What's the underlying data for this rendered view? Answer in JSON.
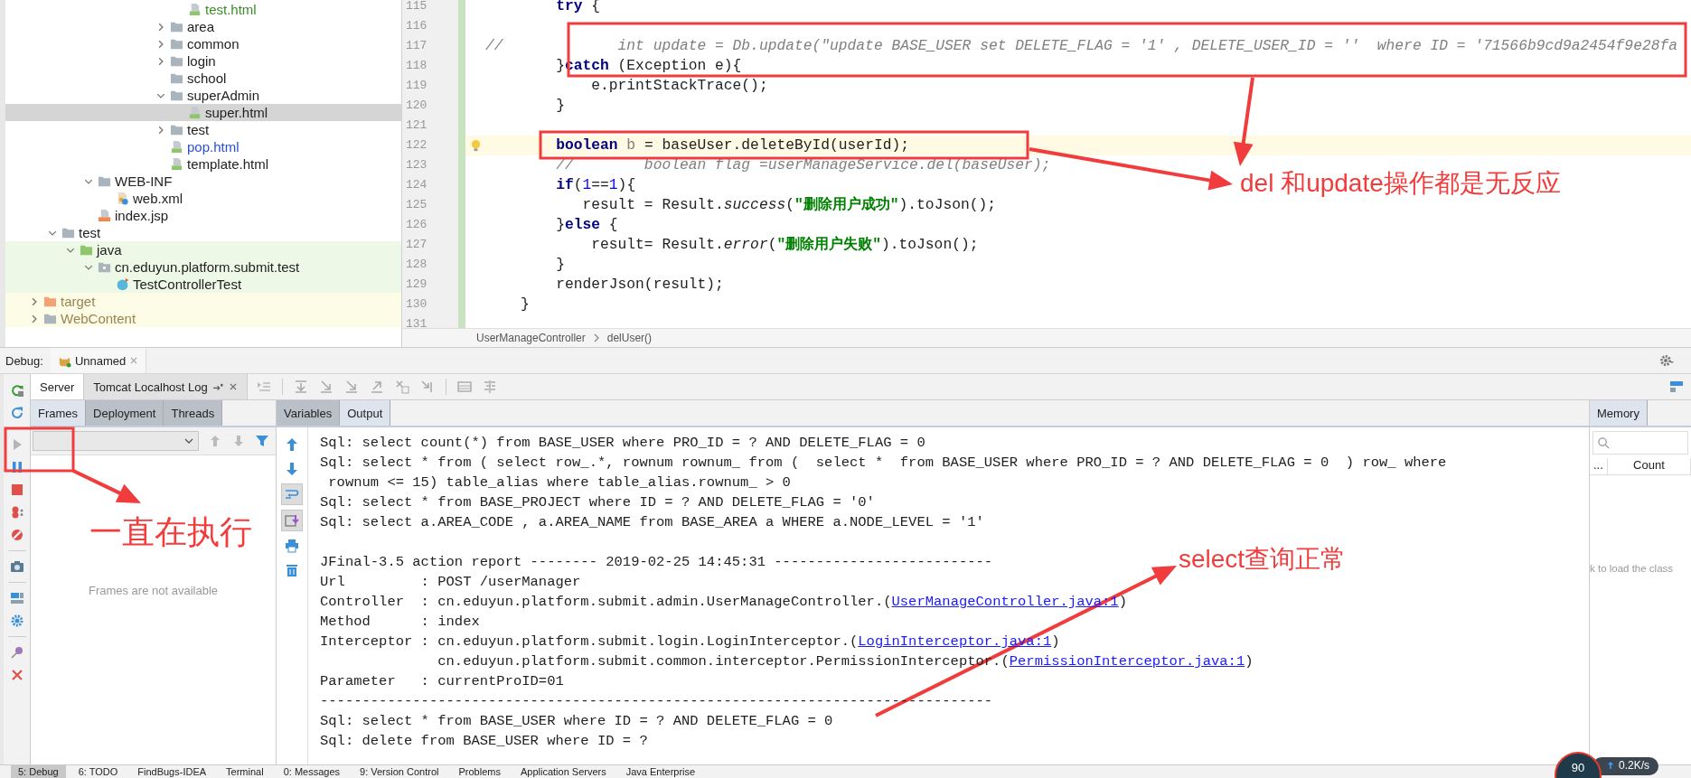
{
  "project_tree": {
    "items": [
      {
        "kind": "hidden",
        "children": [
          {
            "kind": "hidden",
            "children": [
              {
                "kind": "hidden",
                "children": [
                  {
                    "kind": "hidden",
                    "children": [
                      {
                        "kind": "hidden",
                        "children": [
                          {
                            "kind": "hidden",
                            "children": [
                              {
                                "kind": "hidden",
                                "children": [
                                  {
                                    "kind": "hidden",
                                    "children": [
                                      {
                                        "kind": "html",
                                        "label": "test.html",
                                        "selected": false,
                                        "color": "#3c8c2c"
                                      }
                                    ]
                                  },
                                  {
                                    "kind": "folder",
                                    "label": "area",
                                    "selected": false,
                                    "expanded": false
                                  },
                                  {
                                    "kind": "folder",
                                    "label": "common",
                                    "selected": false,
                                    "expanded": false
                                  },
                                  {
                                    "kind": "folder",
                                    "label": "login",
                                    "selected": false,
                                    "expanded": false
                                  },
                                  {
                                    "kind": "folder",
                                    "label": "school",
                                    "selected": false
                                  },
                                  {
                                    "kind": "folder",
                                    "label": "superAdmin",
                                    "selected": false,
                                    "expanded": true,
                                    "children": [
                                      {
                                        "kind": "html",
                                        "label": "super.html",
                                        "selected": true
                                      }
                                    ]
                                  },
                                  {
                                    "kind": "folder",
                                    "label": "test",
                                    "selected": false,
                                    "expanded": false
                                  },
                                  {
                                    "kind": "html",
                                    "label": "pop.html",
                                    "selected": false,
                                    "color": "#2a4fd6"
                                  },
                                  {
                                    "kind": "html",
                                    "label": "template.html",
                                    "selected": false
                                  }
                                ]
                              }
                            ]
                          }
                        ]
                      }
                    ]
                  },
                  {
                    "kind": "folder",
                    "label": "WEB-INF",
                    "selected": false,
                    "expanded": true,
                    "children": [
                      {
                        "kind": "xml",
                        "label": "web.xml",
                        "selected": false
                      }
                    ]
                  },
                  {
                    "kind": "jsp",
                    "label": "index.jsp",
                    "selected": false
                  }
                ]
              }
            ]
          },
          {
            "kind": "folder",
            "label": "test",
            "selected": false,
            "expanded": true,
            "children": [
              {
                "kind": "source",
                "label": "java",
                "selected": false,
                "expanded": true,
                "test_scope": true,
                "children": [
                  {
                    "kind": "package",
                    "label": "cn.eduyun.platform.submit.test",
                    "selected": false,
                    "expanded": true,
                    "test_scope": true,
                    "children": [
                      {
                        "kind": "class",
                        "label": "TestControllerTest",
                        "selected": false,
                        "test_scope": true
                      }
                    ]
                  }
                ]
              }
            ]
          }
        ]
      },
      {
        "kind": "excluded",
        "label": "target",
        "selected": false,
        "expanded": false,
        "excluded": true
      },
      {
        "kind": "folder",
        "label": "WebContent",
        "selected": false,
        "expanded": false,
        "excluded": true
      }
    ]
  },
  "editor": {
    "lines": [
      {
        "no": "115",
        "current": false,
        "segs": [
          {
            "t": "        try",
            "kind": "keyword"
          },
          {
            "t": " {",
            "kind": "plain"
          }
        ]
      },
      {
        "no": "116",
        "current": false
      },
      {
        "no": "117",
        "current": false,
        "segs": [
          {
            "t": "//             int update = Db.update(\"update BASE_USER set DELETE_FLAG = '1' , DELETE_USER_ID = ''  where ID = '71566b9cd9a2454f9e28fa",
            "kind": "comment"
          }
        ]
      },
      {
        "no": "118",
        "current": false,
        "segs": [
          {
            "t": "        }",
            "kind": "plain"
          },
          {
            "t": "catch",
            "kind": "keyword"
          },
          {
            "t": " (Exception e){",
            "kind": "plain"
          }
        ]
      },
      {
        "no": "119",
        "current": false,
        "segs": [
          {
            "t": "            e.printStackTrace();",
            "kind": "plain"
          }
        ]
      },
      {
        "no": "120",
        "current": false,
        "segs": [
          {
            "t": "        }",
            "kind": "plain"
          }
        ]
      },
      {
        "no": "121",
        "current": false
      },
      {
        "no": "122",
        "current": true,
        "segs": [
          {
            "t": "        boolean",
            "kind": "keyword"
          },
          {
            "t": " b",
            "kind": "unused"
          },
          {
            "t": " = baseUser.deleteById(userId);",
            "kind": "plain"
          }
        ]
      },
      {
        "no": "123",
        "current": false,
        "segs": [
          {
            "t": "        //        boolean flag =userManageService.del(baseUser);",
            "kind": "comment"
          }
        ]
      },
      {
        "no": "124",
        "current": false,
        "segs": [
          {
            "t": "        if",
            "kind": "keyword"
          },
          {
            "t": "(",
            "kind": "plain"
          },
          {
            "t": "1",
            "kind": "number"
          },
          {
            "t": "==",
            "kind": "plain"
          },
          {
            "t": "1",
            "kind": "number"
          },
          {
            "t": "){",
            "kind": "plain"
          }
        ]
      },
      {
        "no": "125",
        "current": false,
        "segs": [
          {
            "t": "           result = Result.",
            "kind": "plain"
          },
          {
            "t": "success",
            "kind": "static"
          },
          {
            "t": "(",
            "kind": "plain"
          },
          {
            "t": "\"删除用户成功\"",
            "kind": "string"
          },
          {
            "t": ").toJson();",
            "kind": "plain"
          }
        ]
      },
      {
        "no": "126",
        "current": false,
        "segs": [
          {
            "t": "        }",
            "kind": "plain"
          },
          {
            "t": "else",
            "kind": "keyword"
          },
          {
            "t": " {",
            "kind": "plain"
          }
        ]
      },
      {
        "no": "127",
        "current": false,
        "segs": [
          {
            "t": "            result= Result.",
            "kind": "plain"
          },
          {
            "t": "error",
            "kind": "static"
          },
          {
            "t": "(",
            "kind": "plain"
          },
          {
            "t": "\"删除用户失败\"",
            "kind": "string"
          },
          {
            "t": ").toJson();",
            "kind": "plain"
          }
        ]
      },
      {
        "no": "128",
        "current": false,
        "segs": [
          {
            "t": "        }",
            "kind": "plain"
          }
        ]
      },
      {
        "no": "129",
        "current": false,
        "segs": [
          {
            "t": "        renderJson(result);",
            "kind": "plain"
          }
        ]
      },
      {
        "no": "130",
        "current": false,
        "segs": [
          {
            "t": "    }",
            "kind": "plain"
          }
        ]
      },
      {
        "no": "131",
        "current": false
      }
    ],
    "breadcrumb": [
      "UserManageController",
      "delUser()"
    ]
  },
  "annotations": [
    "del 和update操作都是无反应",
    "一直在执行",
    "select查询正常"
  ],
  "debug": {
    "title": "Debug:",
    "session_tab": "Unnamed",
    "tabs": [
      {
        "label": "Server",
        "selected": true,
        "closable": false
      },
      {
        "label": "Tomcat Localhost Log",
        "selected": false,
        "closable": true
      }
    ],
    "left_tabs": [
      {
        "label": "Frames",
        "selected": true
      },
      {
        "label": "Deployment",
        "selected": false
      },
      {
        "label": "Threads",
        "selected": false
      }
    ],
    "frames_empty": "Frames are not available",
    "output_tabs": [
      {
        "label": "Variables",
        "selected": false
      },
      {
        "label": "Output",
        "selected": true
      }
    ],
    "output_lines": [
      {
        "kind": "text",
        "segs": [
          {
            "t": "Sql: select count(*) from BASE_USER where PRO_ID = ? AND DELETE_FLAG = 0",
            "kind": "text"
          }
        ]
      },
      {
        "kind": "text",
        "segs": [
          {
            "t": "Sql: select * from ( select row_.*, rownum rownum_ from (  select *  from BASE_USER where PRO_ID = ? AND DELETE_FLAG = 0  ) row_ where",
            "kind": "text"
          }
        ]
      },
      {
        "kind": "text",
        "segs": [
          {
            "t": " rownum <= 15) table_alias where table_alias.rownum_ > 0",
            "kind": "text"
          }
        ]
      },
      {
        "kind": "text",
        "segs": [
          {
            "t": "Sql: select * from BASE_PROJECT where ID = ? AND DELETE_FLAG = '0'",
            "kind": "text"
          }
        ]
      },
      {
        "kind": "text",
        "segs": [
          {
            "t": "Sql: select a.AREA_CODE , a.AREA_NAME from BASE_AREA a WHERE a.NODE_LEVEL = '1'",
            "kind": "text"
          }
        ]
      },
      {
        "kind": "blank"
      },
      {
        "kind": "text",
        "segs": [
          {
            "t": "JFinal-3.5 action report -------- 2019-02-25 14:45:31 --------------------------",
            "kind": "text"
          }
        ]
      },
      {
        "kind": "text",
        "segs": [
          {
            "t": "Url         : POST /userManager",
            "kind": "text"
          }
        ]
      },
      {
        "kind": "text",
        "segs": [
          {
            "t": "Controller  : cn.eduyun.platform.submit.admin.UserManageController.(",
            "kind": "text"
          },
          {
            "t": "UserManageController.java:1",
            "kind": "link"
          },
          {
            "t": ")",
            "kind": "text"
          }
        ]
      },
      {
        "kind": "text",
        "segs": [
          {
            "t": "Method      : index",
            "kind": "text"
          }
        ]
      },
      {
        "kind": "text",
        "segs": [
          {
            "t": "Interceptor : cn.eduyun.platform.submit.login.LoginInterceptor.(",
            "kind": "text"
          },
          {
            "t": "LoginInterceptor.java:1",
            "kind": "link"
          },
          {
            "t": ")",
            "kind": "text"
          }
        ]
      },
      {
        "kind": "text",
        "segs": [
          {
            "t": "              cn.eduyun.platform.submit.common.interceptor.PermissionInterceptor.(",
            "kind": "text"
          },
          {
            "t": "PermissionInterceptor.java:1",
            "kind": "link"
          },
          {
            "t": ")",
            "kind": "text"
          }
        ]
      },
      {
        "kind": "text",
        "segs": [
          {
            "t": "Parameter   : currentProID=01",
            "kind": "text"
          }
        ]
      },
      {
        "kind": "text",
        "segs": [
          {
            "t": "--------------------------------------------------------------------------------",
            "kind": "text"
          }
        ]
      },
      {
        "kind": "text",
        "segs": [
          {
            "t": "Sql: select * from BASE_USER where ID = ? AND DELETE_FLAG = 0",
            "kind": "text"
          }
        ]
      },
      {
        "kind": "text",
        "segs": [
          {
            "t": "Sql: delete from BASE_USER where ID = ?",
            "kind": "text"
          }
        ]
      }
    ],
    "memory": {
      "tab": "Memory",
      "columns": [
        "...",
        "Count"
      ],
      "hint": "k to load the class"
    }
  },
  "tool_windows": [
    {
      "label": "5: Debug",
      "selected": true
    },
    {
      "label": "6: TODO",
      "selected": false
    },
    {
      "label": "FindBugs-IDEA",
      "selected": false
    },
    {
      "label": "Terminal",
      "selected": false
    },
    {
      "label": "0: Messages",
      "selected": false
    },
    {
      "label": "9: Version Control",
      "selected": false
    },
    {
      "label": "Problems",
      "selected": false
    },
    {
      "label": "Application Servers",
      "selected": false
    },
    {
      "label": "Java Enterprise",
      "selected": false
    }
  ],
  "net_widget": {
    "value": "90",
    "speed": "0.2K/s"
  }
}
